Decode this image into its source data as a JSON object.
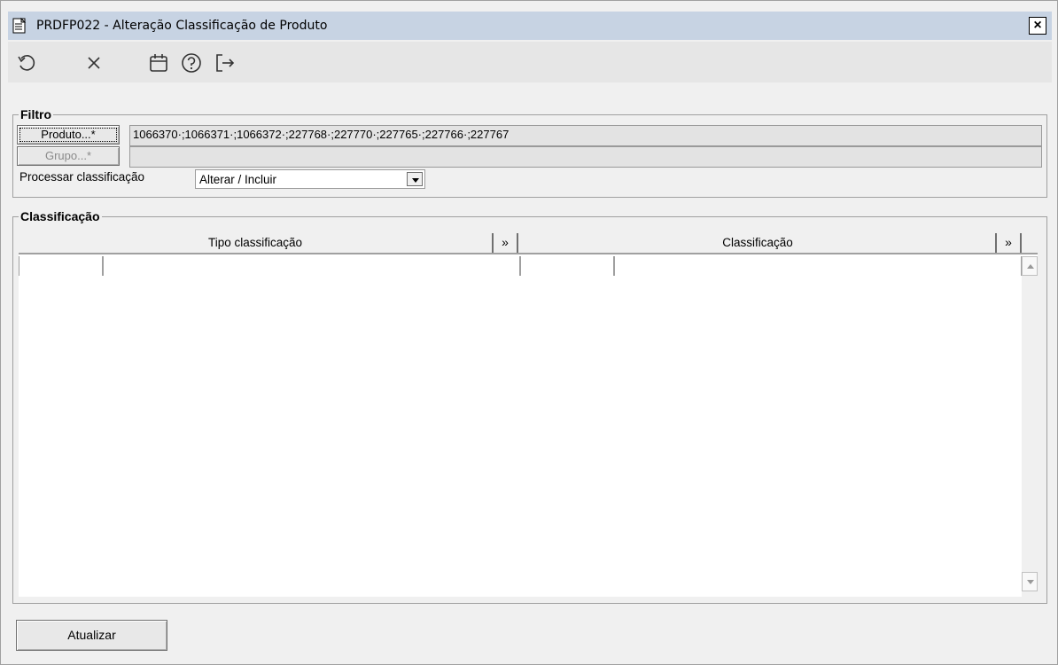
{
  "window": {
    "title": "PRDFP022 - Alteração Classificação de Produto",
    "close_label": "×"
  },
  "toolbar": {
    "buttons": [
      {
        "name": "undo",
        "icon": "undo-icon"
      },
      {
        "name": "cancel",
        "icon": "close-icon"
      },
      {
        "name": "calendar",
        "icon": "calendar-icon"
      },
      {
        "name": "help",
        "icon": "help-icon"
      },
      {
        "name": "exit",
        "icon": "exit-icon"
      }
    ]
  },
  "filtro": {
    "legend": "Filtro",
    "produto_button": "Produto...*",
    "produto_value": "1066370·;1066371·;1066372·;227768·;227770·;227765·;227766·;227767",
    "grupo_button": "Grupo...*",
    "grupo_value": "",
    "processar_label": "Processar classificação",
    "processar_value": "Alterar / Incluir"
  },
  "classificacao": {
    "legend": "Classificação",
    "columns": [
      {
        "label": "Tipo classificação",
        "expand": "»"
      },
      {
        "label": "Classificação",
        "expand": "»"
      }
    ]
  },
  "footer": {
    "atualizar_label": "Atualizar"
  },
  "colors": {
    "titlebar": "#c7d3e3",
    "toolbar": "#e6e6e6",
    "background": "#f0f0f0"
  }
}
